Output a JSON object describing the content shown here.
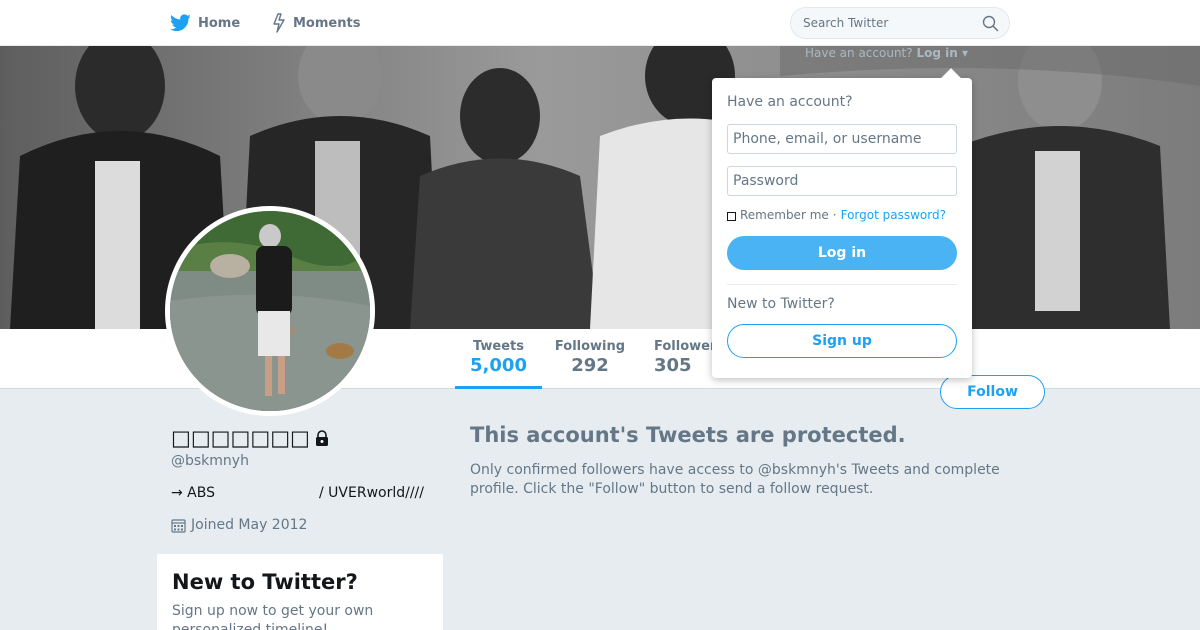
{
  "nav": {
    "home_label": "Home",
    "moments_label": "Moments",
    "search_placeholder": "Search Twitter",
    "home_icon": "twitter-bird-icon",
    "moments_icon": "lightning-icon",
    "search_icon": "magnifier-icon"
  },
  "account_prompt": {
    "question": "Have an account?",
    "login_link": "Log in"
  },
  "profile": {
    "name": "□□□□□□□",
    "handle": "@bskmnyh",
    "bio_part1": "→ ABS",
    "bio_part2": "/ UVERworld////",
    "joined": "Joined May 2012",
    "lock_icon": "lock-icon",
    "calendar_icon": "calendar-icon"
  },
  "stats": {
    "tweets_label": "Tweets",
    "tweets_value": "5,000",
    "following_label": "Following",
    "following_value": "292",
    "followers_label": "Followers",
    "followers_value": "305"
  },
  "follow_label": "Follow",
  "protected": {
    "title": "This account's Tweets are protected.",
    "text": "Only confirmed followers have access to @bskmnyh's Tweets and complete profile. Click the \"Follow\" button to send a follow request."
  },
  "new_box": {
    "title": "New to Twitter?",
    "text": "Sign up now to get your own personalized timeline!"
  },
  "login_dropdown": {
    "title": "Have an account?",
    "username_placeholder": "Phone, email, or username",
    "password_placeholder": "Password",
    "remember_label": "Remember me",
    "separator": "·",
    "forgot_label": "Forgot password?",
    "login_button": "Log in",
    "new_label": "New to Twitter?",
    "signup_button": "Sign up"
  },
  "colors": {
    "accent": "#1da1f2",
    "background": "#e6ecf0",
    "muted_text": "#657786"
  }
}
